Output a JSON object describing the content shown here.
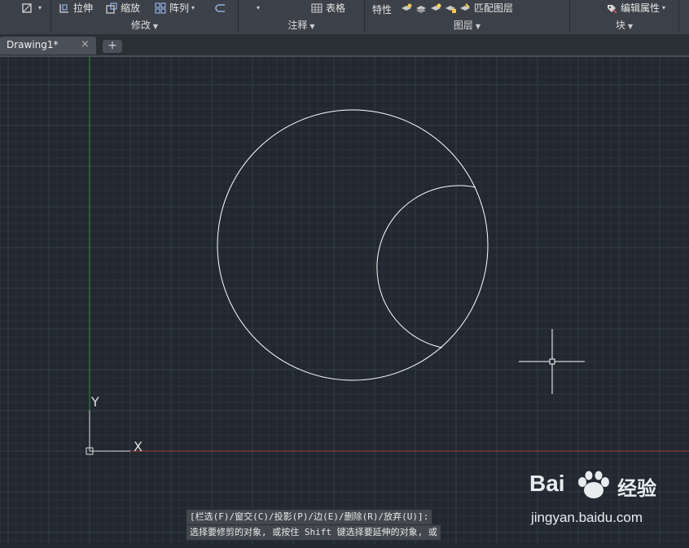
{
  "ribbon": {
    "row1": {
      "stretch": "拉伸",
      "scale": "缩放",
      "array": "阵列",
      "table": "表格",
      "properties": "特性",
      "match_layer": "匹配图层",
      "edit_attributes": "编辑属性"
    },
    "panels": {
      "modify": "修改",
      "annotate": "注释",
      "layers": "图层",
      "block": "块"
    }
  },
  "tabs": {
    "active_title": "Drawing1*",
    "close_glyph": "×",
    "new_tab_glyph": "+"
  },
  "drawing": {
    "ucs_x_label": "X",
    "ucs_y_label": "Y"
  },
  "command_line": {
    "line1": "[栏选(F)/窗交(C)/投影(P)/边(E)/删除(R)/放弃(U)]:",
    "line2": "选择要修剪的对象, 或按住 Shift 键选择要延伸的对象, 或"
  },
  "watermark": {
    "brand": "Bai",
    "brand_cn": "经验",
    "url": "jingyan.baidu.com"
  },
  "colors": {
    "canvas_bg": "#212830",
    "ribbon_bg": "#3c4048",
    "grid_minor": "#2a323c",
    "grid_major": "#323b47",
    "x_axis": "#a83a3a",
    "y_axis": "#3c8a3c",
    "geometry": "#ffffff"
  },
  "icons": [
    "crop-icon",
    "stretch-icon",
    "scale-icon",
    "array-icon",
    "offset-icon",
    "table-icon",
    "layer-icon",
    "match-layer-icon",
    "edit-attributes-icon",
    "baidu-paw-icon"
  ]
}
